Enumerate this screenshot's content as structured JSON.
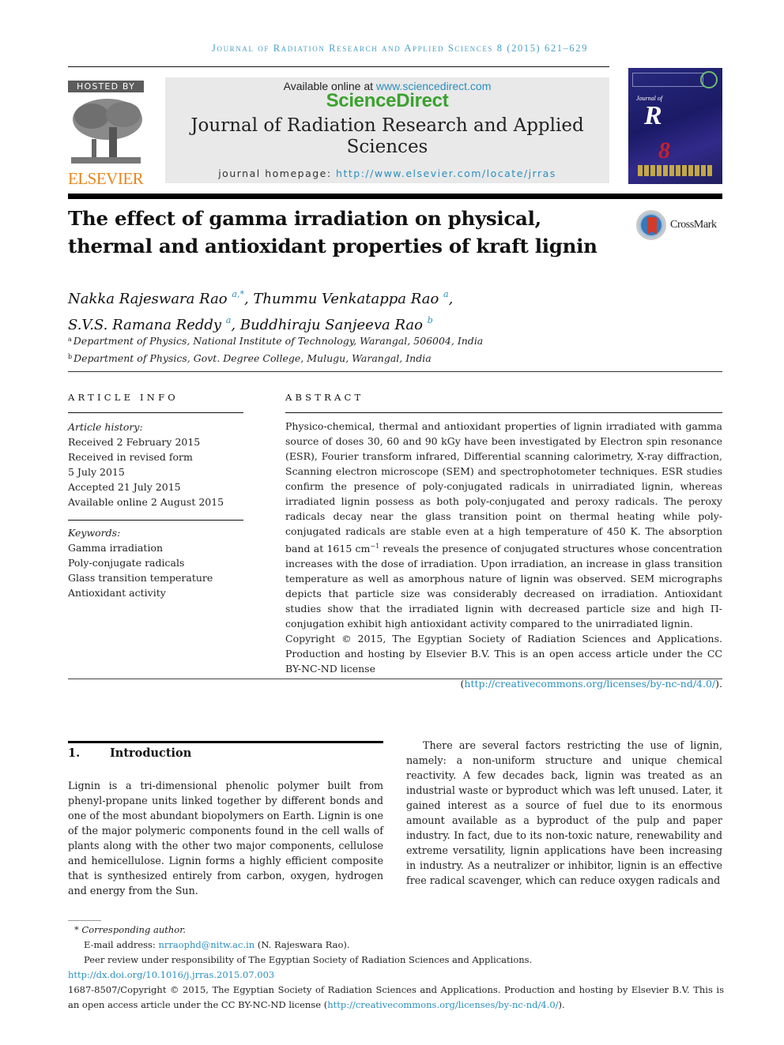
{
  "running_head": "Journal of Radiation Research and Applied Sciences 8 (2015) 621–629",
  "masthead": {
    "hosted_by": "HOSTED BY",
    "publisher": "ELSEVIER",
    "available_online_prefix": "Available online at ",
    "available_online_url": "www.sciencedirect.com",
    "sciencedirect_logo": "ScienceDirect",
    "journal_name": "Journal of Radiation Research and Applied Sciences",
    "homepage_prefix": "journal homepage: ",
    "homepage_url": "http://www.elsevier.com/locate/jrras",
    "cover": {
      "title_line1": "Journal of",
      "big_letter": "R",
      "volume": "8"
    }
  },
  "article": {
    "title": "The effect of gamma irradiation on physical, thermal and antioxidant properties of kraft lignin",
    "crossmark_label": "CrossMark",
    "authors": [
      {
        "name": "Nakka Rajeswara Rao",
        "sup": "a,*",
        "sep": ", "
      },
      {
        "name": "Thummu Venkatappa Rao",
        "sup": "a",
        "sep": ","
      },
      {
        "name": "S.V.S. Ramana Reddy",
        "sup": "a",
        "sep": ", "
      },
      {
        "name": "Buddhiraju Sanjeeva Rao",
        "sup": "b",
        "sep": ""
      }
    ],
    "affiliations": [
      {
        "key": "a",
        "text": "Department of Physics, National Institute of Technology, Warangal, 506004, India"
      },
      {
        "key": "b",
        "text": "Department of Physics, Govt. Degree College, Mulugu, Warangal, India"
      }
    ]
  },
  "article_info": {
    "heading": "ARTICLE INFO",
    "history_label": "Article history:",
    "history": [
      "Received 2 February 2015",
      "Received in revised form",
      "5 July 2015",
      "Accepted 21 July 2015",
      "Available online 2 August 2015"
    ],
    "keywords_label": "Keywords:",
    "keywords": [
      "Gamma irradiation",
      "Poly-conjugate radicals",
      "Glass transition temperature",
      "Antioxidant activity"
    ]
  },
  "abstract": {
    "heading": "ABSTRACT",
    "text_before_sup": "Physico-chemical, thermal and antioxidant properties of lignin irradiated with gamma source of doses 30, 60 and 90 kGy have been investigated by Electron spin resonance (ESR), Fourier transform infrared, Differential scanning calorimetry, X-ray diffraction, Scanning electron microscope (SEM) and spectrophotometer techniques. ESR studies confirm the presence of poly-conjugated radicals in unirradiated lignin, whereas irradiated lignin possess as both poly-conjugated and peroxy radicals. The peroxy radicals decay near the glass transition point on thermal heating while poly-conjugated radicals are stable even at a high temperature of 450 K. The absorption band at 1615 cm",
    "sup": "−1",
    "text_after_sup": " reveals the presence of conjugated structures whose concentration increases with the dose of irradiation. Upon irradiation, an increase in glass transition temperature as well as amorphous nature of lignin was observed. SEM micrographs depicts that particle size was considerably decreased on irradiation. Antioxidant studies show that the irradiated lignin with decreased particle size and high Π-conjugation exhibit high antioxidant activity compared to the unirradiated lignin.",
    "copyright": "Copyright © 2015, The Egyptian Society of Radiation Sciences and Applications. Production and hosting by Elsevier B.V. This is an open access article under the CC BY-NC-ND license",
    "license_url": "http://creativecommons.org/licenses/by-nc-nd/4.0/",
    "license_open": "(",
    "license_close": ")."
  },
  "body": {
    "section_number": "1.",
    "section_title": "Introduction",
    "left_paragraph": "Lignin is a tri-dimensional phenolic polymer built from phenyl-propane units linked together by different bonds and one of the most abundant biopolymers on Earth. Lignin is one of the major polymeric components found in the cell walls of plants along with the other two major components, cellulose and hemicellulose. Lignin forms a highly efficient composite that is synthesized entirely from carbon, oxygen, hydrogen and energy from the Sun.",
    "right_paragraph": "There are several factors restricting the use of lignin, namely: a non-uniform structure and unique chemical reactivity. A few decades back, lignin was treated as an industrial waste or byproduct which was left unused. Later, it gained interest as a source of fuel due to its enormous amount available as a byproduct of the pulp and paper industry. In fact, due to its non-toxic nature, renewability and extreme versatility, lignin applications have been increasing in industry. As a neutralizer or inhibitor, lignin is an effective free radical scavenger, which can reduce oxygen radicals and"
  },
  "footnotes": {
    "corresponding": "* Corresponding author.",
    "email_prefix": "E-mail address: ",
    "email": "nrraophd@nitw.ac.in",
    "email_suffix": " (N. Rajeswara Rao).",
    "peer_review": "Peer review under responsibility of The Egyptian Society of Radiation Sciences and Applications.",
    "doi": "http://dx.doi.org/10.1016/j.jrras.2015.07.003",
    "issn_copyright": "1687-8507/Copyright © 2015, The Egyptian Society of Radiation Sciences and Applications. Production and hosting by Elsevier B.V. This is an open access article under the CC BY-NC-ND license (",
    "license_url": "http://creativecommons.org/licenses/by-nc-nd/4.0/",
    "license_close": ")."
  }
}
